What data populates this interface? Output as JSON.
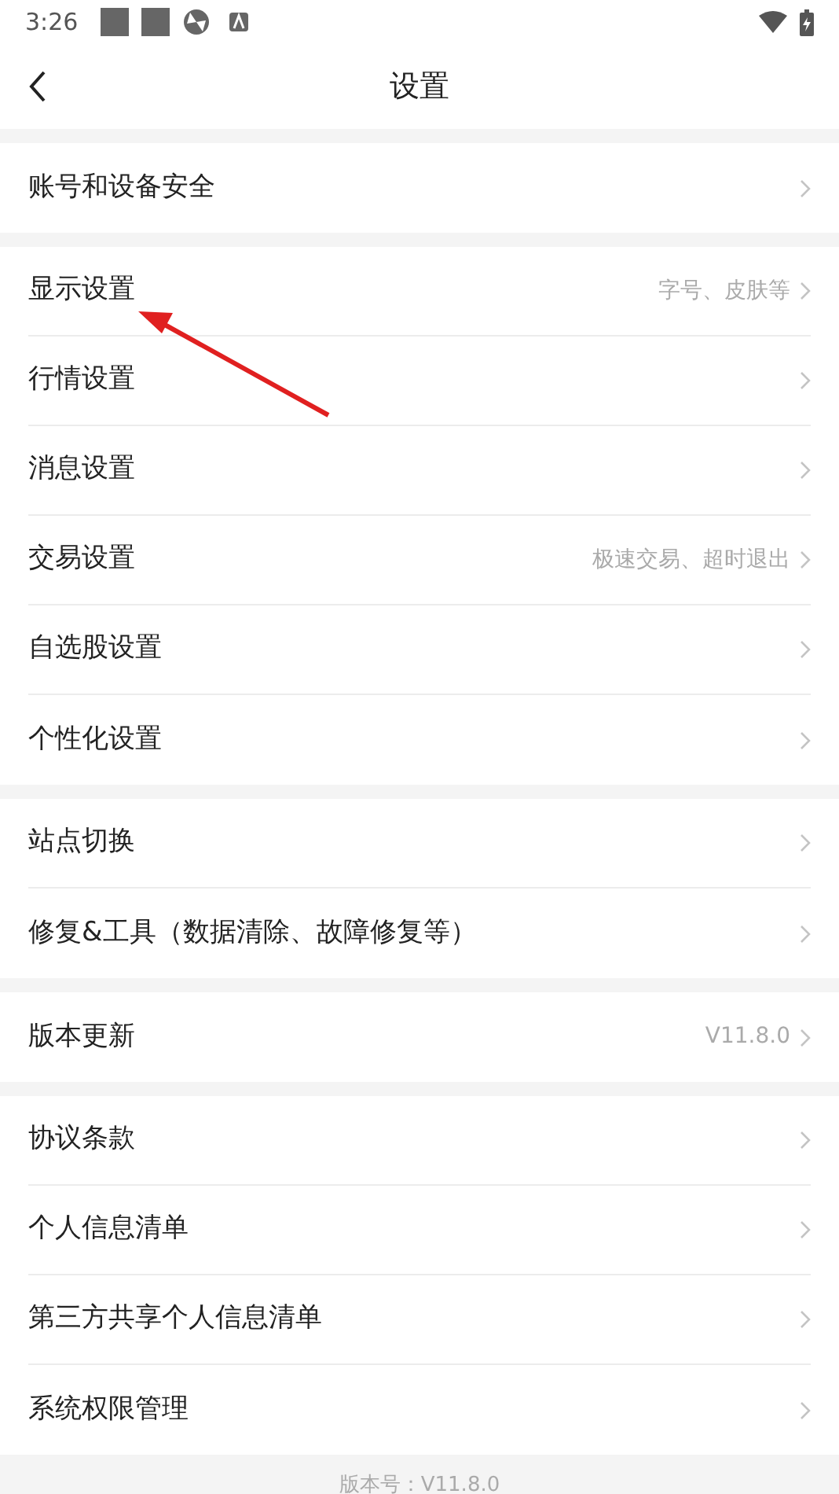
{
  "status_bar": {
    "time": "3:26"
  },
  "header": {
    "title": "设置"
  },
  "groups": [
    {
      "items": [
        {
          "label": "账号和设备安全"
        }
      ]
    },
    {
      "items": [
        {
          "label": "显示设置",
          "hint": "字号、皮肤等"
        },
        {
          "label": "行情设置"
        },
        {
          "label": "消息设置"
        },
        {
          "label": "交易设置",
          "hint": "极速交易、超时退出"
        },
        {
          "label": "自选股设置"
        },
        {
          "label": "个性化设置"
        }
      ]
    },
    {
      "items": [
        {
          "label": "站点切换"
        },
        {
          "label": "修复&工具（数据清除、故障修复等）"
        }
      ]
    },
    {
      "items": [
        {
          "label": "版本更新",
          "hint": "V11.8.0"
        }
      ]
    },
    {
      "items": [
        {
          "label": "协议条款"
        },
        {
          "label": "个人信息清单"
        },
        {
          "label": "第三方共享个人信息清单"
        },
        {
          "label": "系统权限管理"
        }
      ]
    }
  ],
  "footer": {
    "version": "版本号：V11.8.0"
  }
}
